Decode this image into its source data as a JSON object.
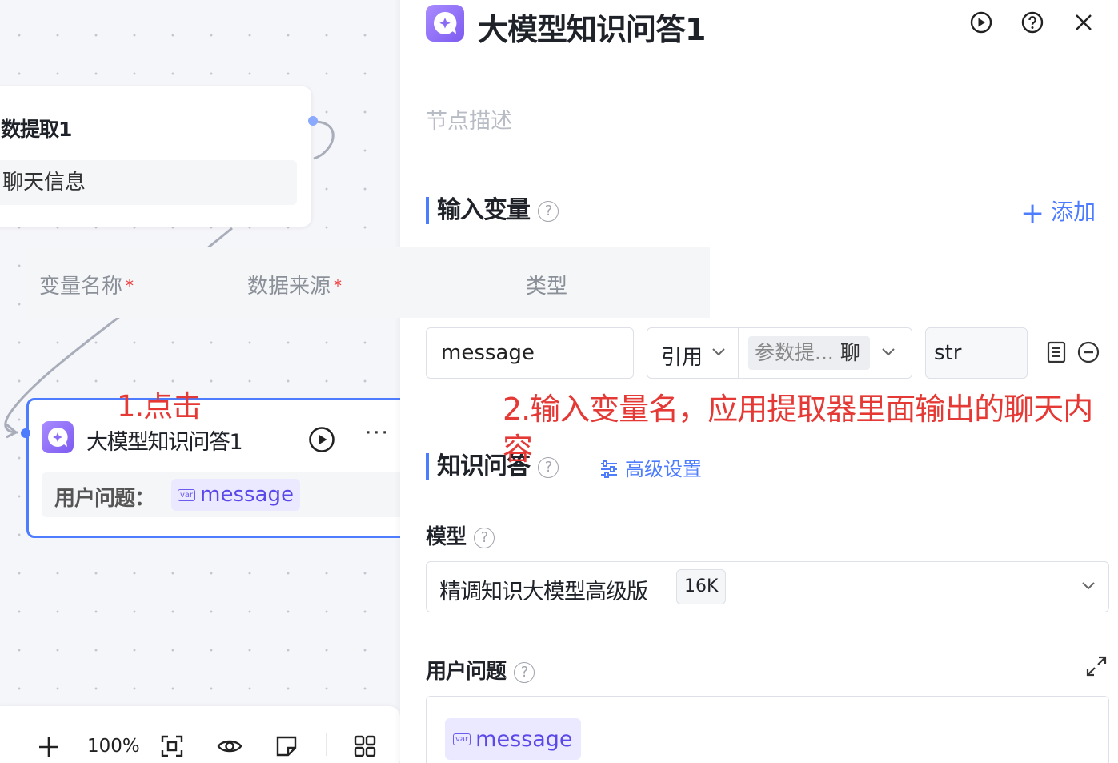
{
  "canvas": {
    "prev_node": {
      "title": "数提取1",
      "field": "聊天信息"
    },
    "selected_node": {
      "title": "大模型知识问答1",
      "row_label": "用户问题：",
      "var_badge": "var",
      "var_name": "message"
    },
    "annotation": "1.点击",
    "toolbar": {
      "zoom": "100%"
    }
  },
  "panel": {
    "title": "大模型知识问答1",
    "description_placeholder": "节点描述",
    "input_vars": {
      "title": "输入变量",
      "add_label": "添加",
      "headers": {
        "name": "变量名称",
        "source": "数据来源",
        "type": "类型",
        "required_mark": "*"
      },
      "row": {
        "name": "message",
        "source_mode": "引用",
        "source_chip": "参数提...",
        "source_chip_suffix": "聊",
        "type": "str"
      }
    },
    "annotation": "2.输入变量名，应用提取器里面输出的聊天内容",
    "knowledge": {
      "title": "知识问答",
      "advanced": "高级设置"
    },
    "model": {
      "label": "模型",
      "value": "精调知识大模型高级版",
      "badge": "16K"
    },
    "question": {
      "label": "用户问题",
      "var_badge": "var",
      "var_name": "message"
    },
    "help_mark": "?"
  },
  "colors": {
    "accent": "#4d7cff",
    "annotation": "#e53935",
    "node_icon": "#8b6cf5"
  }
}
